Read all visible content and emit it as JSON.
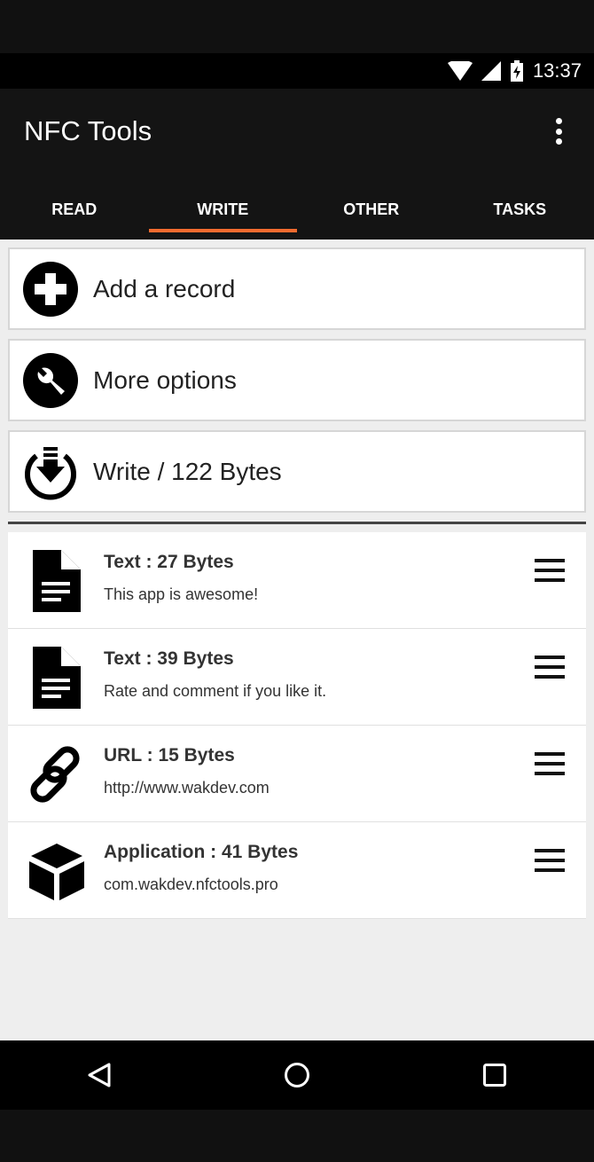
{
  "status": {
    "time": "13:37"
  },
  "app": {
    "title": "NFC Tools"
  },
  "tabs": [
    {
      "label": "READ"
    },
    {
      "label": "WRITE",
      "active": true
    },
    {
      "label": "OTHER"
    },
    {
      "label": "TASKS"
    }
  ],
  "actions": {
    "add": "Add a record",
    "more": "More options",
    "write": "Write / 122 Bytes"
  },
  "records": [
    {
      "title": "Text : 27 Bytes",
      "value": "This app is awesome!",
      "icon": "document-icon"
    },
    {
      "title": "Text : 39 Bytes",
      "value": "Rate and comment if you like it.",
      "icon": "document-icon"
    },
    {
      "title": "URL : 15 Bytes",
      "value": "http://www.wakdev.com",
      "icon": "link-icon"
    },
    {
      "title": "Application : 41 Bytes",
      "value": "com.wakdev.nfctools.pro",
      "icon": "cube-icon"
    }
  ],
  "accent": "#f26b2f"
}
